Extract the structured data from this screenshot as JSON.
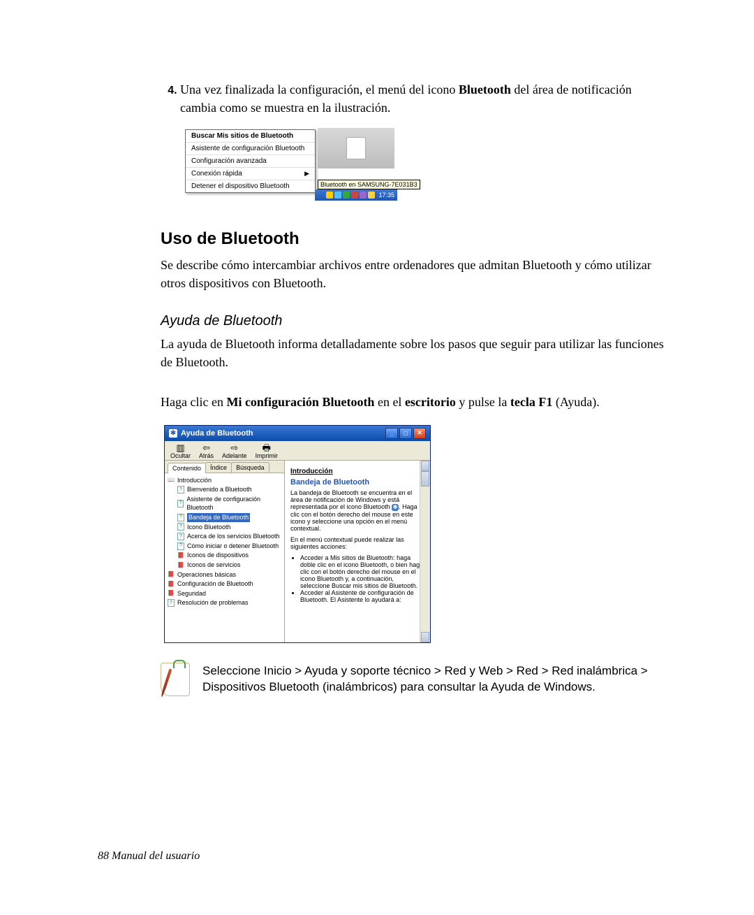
{
  "step": {
    "num": "4.",
    "before": "Una vez finalizada la configuración, el menú del icono ",
    "bold": "Bluetooth",
    "after": " del área de notificación cambia como se muestra en la ilustración."
  },
  "fig1": {
    "menu": [
      "Buscar Mis sitios de Bluetooth",
      "Asistente de configuración Bluetooth",
      "Configuración avanzada",
      "Conexión rápida",
      "Detener el dispositivo Bluetooth"
    ],
    "tooltip": "Bluetooth en SAMSUNG-7E031B3",
    "clock": "17:35"
  },
  "section_title": "Uso de Bluetooth",
  "section_body": "Se describe cómo intercambiar archivos entre ordenadores que admitan Bluetooth y cómo utilizar otros dispositivos con Bluetooth.",
  "subsection_title": "Ayuda de Bluetooth",
  "sub_body": "La ayuda de Bluetooth informa detalladamente sobre los pasos que seguir para utilizar las funciones de Bluetooth.",
  "instruction": {
    "p1": "Haga clic en ",
    "b1": "Mi configuración Bluetooth",
    "p2": " en el ",
    "b2": "escritorio",
    "p3": " y pulse la ",
    "b3": "tecla F1",
    "p4": " (Ayuda)."
  },
  "help": {
    "title": "Ayuda de Bluetooth",
    "toolbar": [
      "Ocultar",
      "Atrás",
      "Adelante",
      "Imprimir"
    ],
    "tabs": [
      "Contenido",
      "Índice",
      "Búsqueda"
    ],
    "tree_root": "Introducción",
    "tree_items": [
      "Bienvenido a Bluetooth",
      "Asistente de configuración Bluetooth",
      "Bandeja de Bluetooth",
      "Icono Bluetooth",
      "Acerca de los servicios Bluetooth",
      "Cómo iniciar o detener Bluetooth",
      "Iconos de dispositivos",
      "Iconos de servicios"
    ],
    "tree_tail": [
      "Operaciones básicas",
      "Configuración de Bluetooth",
      "Seguridad",
      "Resolución de problemas"
    ],
    "selected_index": 2,
    "content": {
      "heading": "Introducción",
      "title": "Bandeja de Bluetooth",
      "para1": "La bandeja de Bluetooth se encuentra en el área de notificación de Windows y está representada por el icono Bluetooth ",
      "para1b": ". Haga clic con el botón derecho del mouse en este icono y seleccione una opción en el menú contextual.",
      "para2": "En el menú contextual puede realizar las siguientes acciones:",
      "li1": "Acceder a Mis sitios de Bluetooth: haga doble clic en el icono Bluetooth, o bien haga clic con el botón derecho del mouse en el icono Bluetooth y, a continuación, seleccione Buscar mis sitios de Bluetooth.",
      "li2": "Acceder al Asistente de configuración de Bluetooth. El Asistente lo ayudará a:"
    }
  },
  "note": "Seleccione Inicio > Ayuda y soporte técnico > Red y Web > Red > Red inalámbrica > Dispositivos Bluetooth (inalámbricos) para consultar la Ayuda de Windows.",
  "footer": "88  Manual del usuario"
}
